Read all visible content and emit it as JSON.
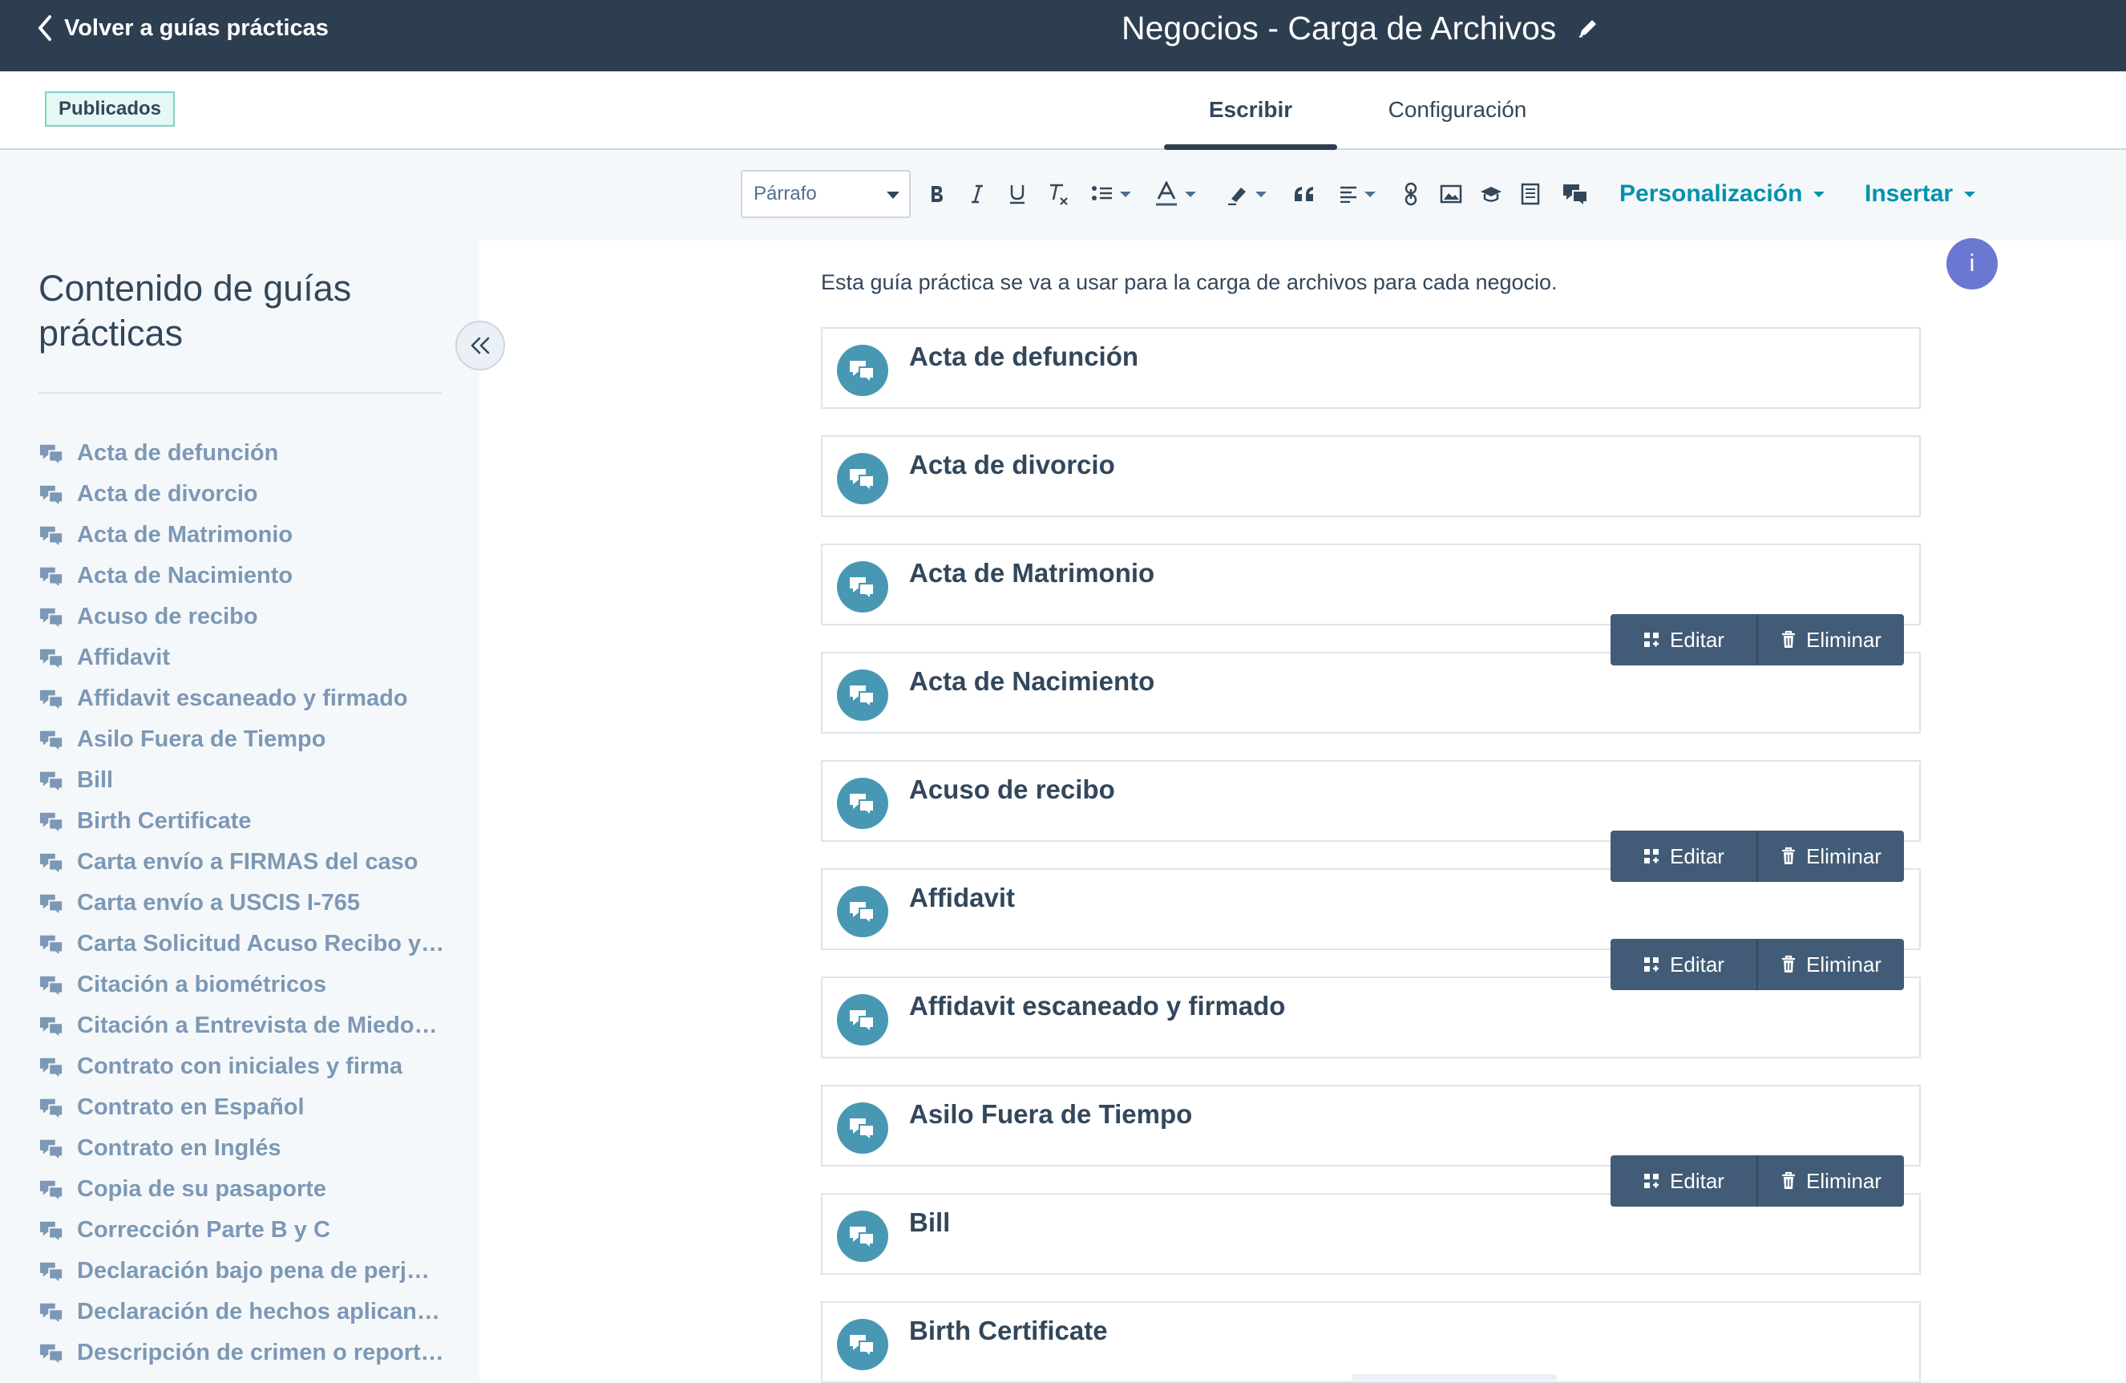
{
  "header": {
    "back_label": "Volver a guías prácticas",
    "title": "Negocios - Carga de Archivos"
  },
  "status_badge": "Publicados",
  "tabs": [
    {
      "label": "Escribir",
      "active": true
    },
    {
      "label": "Configuración",
      "active": false
    }
  ],
  "toolbar": {
    "paragraph_select": "Párrafo",
    "buttons": [
      "bold-icon",
      "italic-icon",
      "underline-icon",
      "clear-format-icon",
      "list-icon",
      "text-color-icon",
      "highlight-icon",
      "quote-icon",
      "align-icon",
      "link-icon",
      "image-icon",
      "course-icon",
      "document-icon",
      "playbook-icon"
    ],
    "personalization_label": "Personalización",
    "insert_label": "Insertar"
  },
  "sidebar": {
    "title": "Contenido de guías prácticas",
    "items": [
      "Acta de defunción",
      "Acta de divorcio",
      "Acta de Matrimonio",
      "Acta de Nacimiento",
      "Acuso de recibo",
      "Affidavit",
      "Affidavit escaneado y firmado",
      "Asilo Fuera de Tiempo",
      "Bill",
      "Birth Certificate",
      "Carta envío a FIRMAS del caso",
      "Carta envío a USCIS I-765",
      "Carta Solicitud Acuso Recibo y…",
      "Citación a biométricos",
      "Citación a Entrevista de Miedo…",
      "Contrato con iniciales y firma",
      "Contrato en Español",
      "Contrato en Inglés",
      "Copia de su pasaporte",
      "Corrección Parte B y C",
      "Declaración bajo pena de perj…",
      "Declaración de hechos aplican…",
      "Descripción de crimen o report…"
    ]
  },
  "info_label": "i",
  "main": {
    "intro": "Esta guía práctica se va a usar para la carga de archivos para cada negocio.",
    "cards": [
      "Acta de defunción",
      "Acta de divorcio",
      "Acta de Matrimonio",
      "Acta de Nacimiento",
      "Acuso de recibo",
      "Affidavit",
      "Affidavit escaneado y firmado",
      "Asilo Fuera de Tiempo",
      "Bill",
      "Birth Certificate"
    ],
    "action_edit": "Editar",
    "action_delete": "Eliminar"
  },
  "colors": {
    "header_bg": "#2d3e50",
    "accent": "#0091ae",
    "card_icon": "#4898b3",
    "action_bar": "#425b76",
    "info_button": "#6a78d1"
  }
}
